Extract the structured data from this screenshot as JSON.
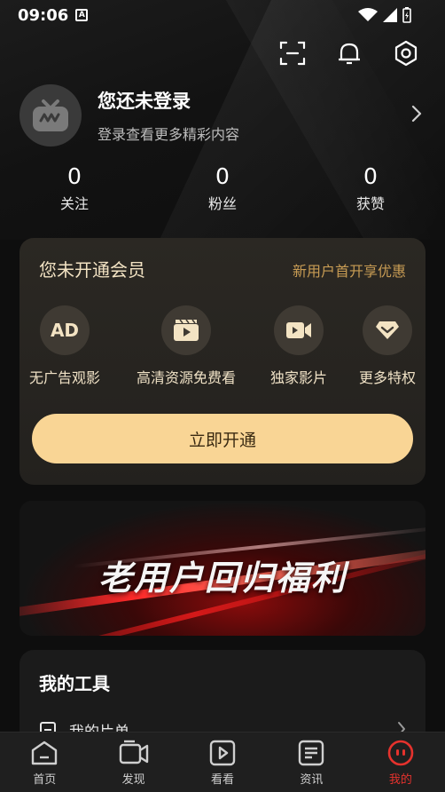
{
  "status_bar": {
    "time": "09:06",
    "notification_icon": "A"
  },
  "header": {
    "icons": [
      "scan-icon",
      "bell-icon",
      "settings-icon"
    ]
  },
  "profile": {
    "name": "您还未登录",
    "subtitle": "登录查看更多精彩内容"
  },
  "stats": [
    {
      "value": "0",
      "label": "关注"
    },
    {
      "value": "0",
      "label": "粉丝"
    },
    {
      "value": "0",
      "label": "获赞"
    }
  ],
  "vip": {
    "title": "您未开通会员",
    "promo": "新用户首开享优惠",
    "benefits": [
      {
        "label": "无广告观影",
        "icon": "ad-icon",
        "icon_text": "AD"
      },
      {
        "label": "高清资源免费看",
        "icon": "film-icon"
      },
      {
        "label": "独家影片",
        "icon": "video-camera-icon"
      },
      {
        "label": "更多特权",
        "icon": "diamond-icon"
      }
    ],
    "button": "立即开通"
  },
  "banner": {
    "text": "老用户回归福利"
  },
  "tools": {
    "title": "我的工具",
    "items": [
      {
        "label": "我的片单"
      }
    ]
  },
  "bottom_nav": [
    {
      "label": "首页",
      "icon": "home-icon"
    },
    {
      "label": "发现",
      "icon": "discover-icon"
    },
    {
      "label": "看看",
      "icon": "play-icon"
    },
    {
      "label": "资讯",
      "icon": "news-icon"
    },
    {
      "label": "我的",
      "icon": "profile-icon",
      "active": true
    }
  ],
  "colors": {
    "accent": "#e5322d",
    "vip_gold": "#f9d595",
    "vip_text": "#c89c54"
  }
}
